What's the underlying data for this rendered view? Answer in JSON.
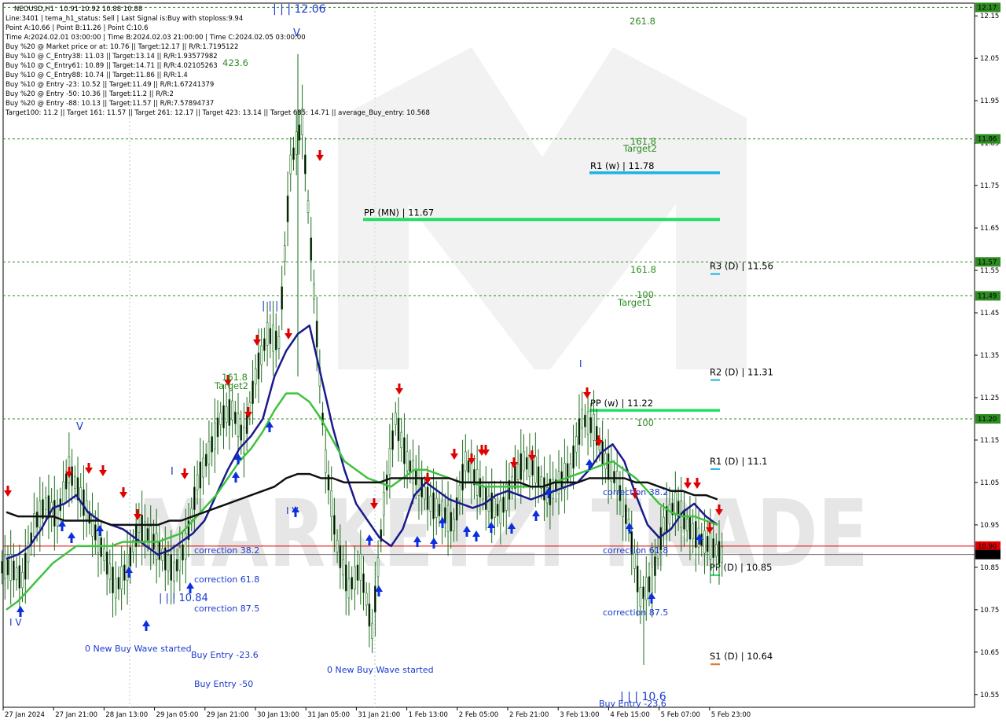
{
  "chart_data": {
    "type": "line",
    "symbol": "NEOUSD,H1",
    "ohlc_text": "10.91 10.92 10.88 10.88",
    "info_lines": [
      "Line:3401 | tema_h1_status: Sell | Last Signal is:Buy with stoploss:9.94",
      "Point A:10.66 | Point B:11.26 | Point C:10.6",
      "Time A:2024.02.01 03:00:00 | Time B:2024.02.03 21:00:00 | Time C:2024.02.05 03:00:00",
      "Buy %20 @ Market price or at: 10.76 || Target:12.17 || R/R:1.7195122",
      "Buy %10 @ C_Entry38: 11.03 || Target:13.14 || R/R:1.93577982",
      "Buy %10 @ C_Entry61: 10.89 || Target:14.71 || R/R:4.02105263",
      "Buy %10 @ C_Entry88: 10.74 || Target:11.86 || R/R:1.4",
      "Buy %10 @ Entry -23: 10.52 || Target:11.49 || R/R:1.67241379",
      "Buy %20 @ Entry -50: 10.36 || Target:11.2 || R/R:2",
      "Buy %20 @ Entry -88: 10.13 || Target:11.57 || R/R:7.57894737",
      "Target100: 11.2 || Target 161: 11.57 || Target 261: 12.17 || Target 423: 13.14 || Target 685: 14.71 || average_Buy_entry: 10.568"
    ],
    "y_range": [
      10.52,
      12.18
    ],
    "y_ticks": [
      "12.15",
      "12.05",
      "11.95",
      "11.85",
      "11.75",
      "11.65",
      "11.55",
      "11.45",
      "11.35",
      "11.25",
      "11.15",
      "11.05",
      "10.95",
      "10.85",
      "10.75",
      "10.65",
      "10.55"
    ],
    "x_ticks": [
      "27 Jan 2024",
      "27 Jan 21:00",
      "28 Jan 13:00",
      "29 Jan 05:00",
      "29 Jan 21:00",
      "30 Jan 13:00",
      "31 Jan 05:00",
      "31 Jan 21:00",
      "1 Feb 13:00",
      "2 Feb 05:00",
      "2 Feb 21:00",
      "3 Feb 13:00",
      "4 Feb 15:00",
      "5 Feb 07:00",
      "5 Feb 23:00"
    ],
    "price_badges": [
      {
        "text": "12.17",
        "value": 12.17,
        "color": "#2e8b22"
      },
      {
        "text": "11.86",
        "value": 11.86,
        "color": "#2e8b22"
      },
      {
        "text": "11.57",
        "value": 11.57,
        "color": "#2e8b22"
      },
      {
        "text": "11.49",
        "value": 11.49,
        "color": "#2e8b22"
      },
      {
        "text": "11.20",
        "value": 11.2,
        "color": "#2e8b22"
      },
      {
        "text": "10.90",
        "value": 10.9,
        "color": "#e00000"
      },
      {
        "text": "10.88",
        "value": 10.88,
        "color": "#000000"
      }
    ],
    "dashed_levels": [
      12.17,
      11.86,
      11.57,
      11.49,
      11.2
    ],
    "current_price_line": 10.9,
    "bid_line": 10.88,
    "pivot_levels": [
      {
        "label": "R1 (w) | 11.78",
        "value": 11.78,
        "color": "#1eb0e8",
        "type": "weekly"
      },
      {
        "label": "PP (MN) | 11.67",
        "value": 11.67,
        "color": "#22dd66",
        "type": "monthly"
      },
      {
        "label": "PP (w) | 11.22",
        "value": 11.22,
        "color": "#22dd66",
        "type": "weekly"
      },
      {
        "label": "R3 (D) | 11.56",
        "value": 11.56,
        "color": "#1eb0e8",
        "type": "daily"
      },
      {
        "label": "R2 (D) | 11.31",
        "value": 11.31,
        "color": "#1eb0e8",
        "type": "daily"
      },
      {
        "label": "R1 (D) | 11.1",
        "value": 11.1,
        "color": "#1eb0e8",
        "type": "daily"
      },
      {
        "label": "PP (D) | 10.85",
        "value": 10.85,
        "color": "#22dd66",
        "type": "daily"
      },
      {
        "label": "S1 (D) | 10.64",
        "value": 10.64,
        "color": "#e07a22",
        "type": "daily"
      }
    ],
    "fib_labels": [
      "261.8",
      "423.6",
      "161.8",
      "Target2",
      "161.8",
      "100",
      "Target1",
      "100",
      "161.8",
      "Target2"
    ],
    "wave_labels": [
      "| | | 12.06",
      "V",
      "| | |",
      "I",
      "V",
      "I V",
      "I V",
      "I",
      "| | | 10.84",
      "| | | 10.6"
    ],
    "annotations": [
      "correction 38.2",
      "correction 61.8",
      "correction 87.5",
      "0 New Buy Wave started",
      "Buy Entry -23.6",
      "Buy Entry -50",
      "0 New Buy Wave started",
      "correction 38.2",
      "correction 61.8",
      "correction 87.5",
      "Buy Entry -23.6"
    ],
    "watermark": "MARKETZI TRADE",
    "series": [
      {
        "role": "tema_fast",
        "color": "#1a1a8c",
        "values": [
          10.87,
          10.88,
          10.9,
          10.94,
          10.99,
          11,
          11.02,
          10.98,
          10.96,
          10.95,
          10.94,
          10.92,
          10.9,
          10.88,
          10.89,
          10.91,
          10.93,
          10.96,
          11.02,
          11.08,
          11.13,
          11.16,
          11.2,
          11.3,
          11.36,
          11.4,
          11.42,
          11.3,
          11.18,
          11.08,
          11,
          10.96,
          10.92,
          10.9,
          10.94,
          11.02,
          11.05,
          11.03,
          11.01,
          11,
          10.99,
          11,
          11.02,
          11.03,
          11.02,
          11.01,
          11.02,
          11.03,
          11.04,
          11.05,
          11.08,
          11.12,
          11.14,
          11.1,
          11.02,
          10.95,
          10.92,
          10.94,
          10.98,
          11,
          10.97,
          10.95
        ]
      },
      {
        "role": "ma_mid",
        "color": "#3ec23e",
        "values": [
          10.75,
          10.77,
          10.8,
          10.83,
          10.86,
          10.88,
          10.9,
          10.9,
          10.9,
          10.9,
          10.91,
          10.91,
          10.91,
          10.91,
          10.92,
          10.93,
          10.96,
          10.99,
          11.02,
          11.06,
          11.1,
          11.13,
          11.17,
          11.22,
          11.26,
          11.26,
          11.24,
          11.2,
          11.15,
          11.1,
          11.08,
          11.06,
          11.05,
          11.04,
          11.06,
          11.08,
          11.08,
          11.07,
          11.06,
          11.05,
          11.05,
          11.04,
          11.04,
          11.04,
          11.04,
          11.04,
          11.04,
          11.05,
          11.06,
          11.07,
          11.08,
          11.09,
          11.1,
          11.08,
          11.06,
          11.03,
          11,
          10.98,
          10.97,
          10.97,
          10.96,
          10.95
        ]
      },
      {
        "role": "ma_slow",
        "color": "#111111",
        "values": [
          10.98,
          10.97,
          10.97,
          10.97,
          10.97,
          10.96,
          10.96,
          10.96,
          10.96,
          10.95,
          10.95,
          10.95,
          10.95,
          10.95,
          10.96,
          10.96,
          10.97,
          10.98,
          10.99,
          11,
          11.01,
          11.02,
          11.03,
          11.04,
          11.06,
          11.07,
          11.07,
          11.06,
          11.06,
          11.05,
          11.05,
          11.05,
          11.05,
          11.06,
          11.06,
          11.06,
          11.06,
          11.06,
          11.06,
          11.05,
          11.05,
          11.05,
          11.05,
          11.05,
          11.05,
          11.04,
          11.04,
          11.05,
          11.05,
          11.05,
          11.06,
          11.06,
          11.06,
          11.06,
          11.05,
          11.05,
          11.04,
          11.03,
          11.03,
          11.02,
          11.02,
          11.01
        ]
      },
      {
        "role": "price_close",
        "color": "#1e6e1e",
        "values": [
          10.85,
          10.82,
          10.95,
          11,
          10.97,
          11.08,
          11.02,
          10.95,
          10.88,
          10.8,
          10.85,
          10.95,
          10.92,
          10.88,
          10.84,
          10.9,
          11.05,
          11.12,
          11.2,
          11.22,
          11.15,
          11.3,
          11.4,
          11.38,
          11.8,
          11.9,
          11.5,
          11.1,
          10.9,
          10.8,
          10.85,
          10.7,
          11,
          11.2,
          11.1,
          11.05,
          11,
          10.98,
          10.95,
          11.1,
          11.05,
          11,
          10.98,
          11.05,
          11.1,
          11.08,
          11.02,
          11.05,
          11.08,
          11.2,
          11.18,
          11.1,
          11.05,
          10.95,
          10.78,
          10.82,
          10.95,
          11,
          10.95,
          10.92,
          10.9,
          10.88
        ]
      }
    ]
  }
}
